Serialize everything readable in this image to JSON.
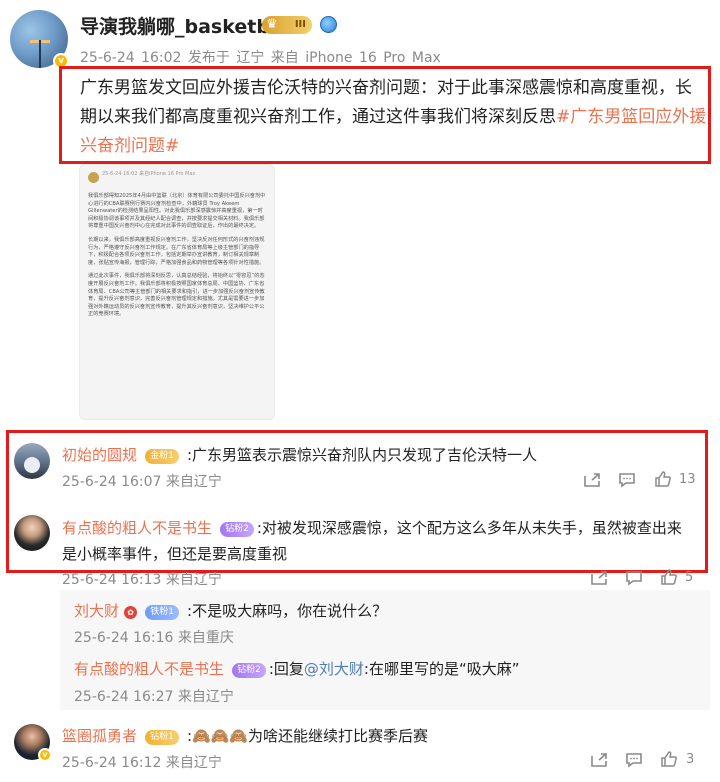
{
  "post": {
    "username": "导演我躺哪_basketball",
    "crown_level": "III",
    "meta": "25-6-24 16:02  发布于 辽宁  来自 iPhone 16 Pro Max",
    "text": "广东男篮发文回应外援吉伦沃特的兴奋剂问题：对于此事深感震惊和高度重视，长期以来我们都高度重视兴奋剂工作，通过这件事我们将深刻反思",
    "topic": "#广东男篮回应外援兴奋剂问题#",
    "embed": {
      "header": "25-6-24 16:02 来自iPhone 16 Pro Max",
      "paragraphs": [
        "我俱乐部得知2025年4月由中篮联（北京）体育有限公司委托中国反兴奋剂中心进行的CBA联赛例行赛内兴奋剂检查中，外籍球员 Troy Akeem Gillenwater的检测结果呈阳性。对此我俱乐部深感震惊并高度重视，第一时间积极协调该事项并及其经纪人配合调查，并按要求提交相关材料。我俱乐部将尊重中国反兴奋剂中心在完成对此事件的调查取证后，作出的最终决定。",
        "长期以来，我俱乐部高度重视反兴奋剂工作，坚决反对任何形式的兴奋剂违规行为，严格遵守反兴奋剂工作规定。在广东省体育局等上级主管部门的指导下，积极配合各项反兴奋剂工作，包括定期举办宣讲教育，制订相关规章制度，张贴宣传海报，管理行踪，严格加强食品和药物管理等各项针对性措施。",
        "通过此次事件，我俱乐部将深刻反思，认真总结经验，将始终以“零容忍”的态度开展反兴奋剂工作。我俱乐部将积极按照国家体育总局、中国篮协、广东省体育局、CBA公司等主管部门的相关要求和指引，进一步加强反兴奋剂宣传教育，提升反兴奋剂意识，完善反兴奋剂管理规定和措施。尤其是需要进一步加强对外籍运动员的反兴奋剂宣传教育，提升其反兴奋剂意识，坚决维护公平公正的竞赛环境。"
      ]
    }
  },
  "comments": [
    {
      "name": "初始的圆规",
      "badge": "金粉1",
      "text": ":广东男篮表示震惊兴奋剂队内只发现了吉伦沃特一人",
      "meta": "25-6-24 16:07 来自辽宁",
      "likes": "13"
    },
    {
      "name": "有点酸的粗人不是书生",
      "badge": "钻粉2",
      "text": ":对被发现深感震惊，这个配方这么多年从未失手，虽然被查出来是小概率事件，但还是要高度重视",
      "meta": "25-6-24 16:13 来自辽宁",
      "likes": "5",
      "replies": [
        {
          "name": "刘大财",
          "badge": "铁粉1",
          "text": ":不是吸大麻吗，你在说什么？",
          "meta": "25-6-24 16:16 来自重庆"
        },
        {
          "name": "有点酸的粗人不是书生",
          "badge": "钻粉2",
          "reply_prefix": ":回复",
          "reply_at": "@刘大财",
          "text": ":在哪里写的是“吸大麻”",
          "meta": "25-6-24 16:27 来自辽宁"
        }
      ]
    },
    {
      "name": "篮圈孤勇者",
      "badge": "钻粉1",
      "emoji": "🙈🙈🙈",
      "text": "为啥还能继续打比赛季后赛",
      "meta": "25-6-24 16:12 来自辽宁",
      "likes": "3"
    }
  ],
  "colors": {
    "highlight_border": "#e21b1b",
    "name": "#eb7350",
    "meta": "#8a8a8a"
  },
  "icons": [
    "share-icon",
    "comment-icon",
    "like-icon",
    "globe-icon",
    "crown-icon",
    "verified-icon"
  ]
}
